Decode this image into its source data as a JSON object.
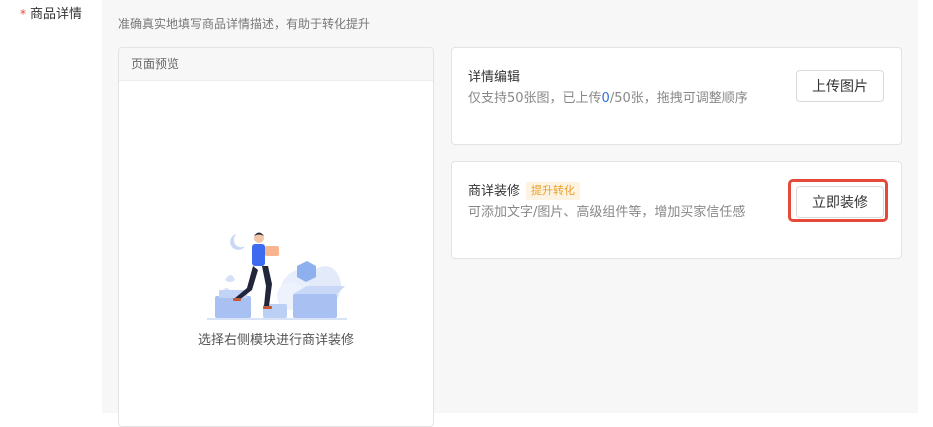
{
  "field": {
    "required_mark": "*",
    "label": "商品详情"
  },
  "hint": "准确真实地填写商品详情描述，有助于转化提升",
  "preview": {
    "header": "页面预览",
    "empty_text": "选择右侧模块进行商详装修"
  },
  "detail_edit": {
    "title": "详情编辑",
    "desc_prefix": "仅支持50张图，已上传",
    "uploaded_count": "0",
    "desc_suffix": "/50张，拖拽可调整顺序",
    "button": "上传图片"
  },
  "decorate": {
    "title": "商详装修",
    "badge": "提升转化",
    "desc": "可添加文字/图片、高级组件等，增加买家信任感",
    "button": "立即装修"
  },
  "colors": {
    "required": "#e5483a",
    "highlight_border": "#e4493a",
    "badge_text": "#e8a02a",
    "link_number": "#2f6fe4"
  }
}
